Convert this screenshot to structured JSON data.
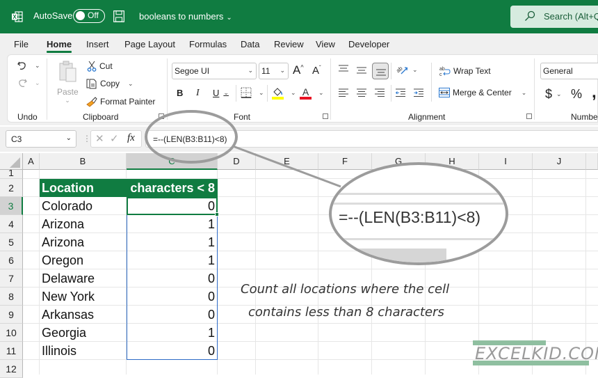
{
  "titlebar": {
    "autosave_label": "AutoSave",
    "autosave_state": "Off",
    "document_name": "booleans to numbers",
    "search_placeholder": "Search (Alt+Q)",
    "colors": {
      "brand": "#107c41"
    }
  },
  "tabs": [
    {
      "label": "File",
      "active": false
    },
    {
      "label": "Home",
      "active": true
    },
    {
      "label": "Insert",
      "active": false
    },
    {
      "label": "Page Layout",
      "active": false
    },
    {
      "label": "Formulas",
      "active": false
    },
    {
      "label": "Data",
      "active": false
    },
    {
      "label": "Review",
      "active": false
    },
    {
      "label": "View",
      "active": false
    },
    {
      "label": "Developer",
      "active": false
    }
  ],
  "ribbon": {
    "undo": {
      "group": "Undo"
    },
    "clipboard": {
      "group": "Clipboard",
      "paste": "Paste",
      "cut": "Cut",
      "copy": "Copy",
      "format_painter": "Format Painter"
    },
    "font": {
      "group": "Font",
      "font_name": "Segoe UI",
      "font_size": "11",
      "bold": "B",
      "italic": "I",
      "underline": "U"
    },
    "alignment": {
      "group": "Alignment",
      "wrap_text": "Wrap Text",
      "merge_center": "Merge & Center"
    },
    "number": {
      "group": "Number",
      "format": "General",
      "currency": "$",
      "percent": "%",
      "comma": ","
    }
  },
  "formula_bar": {
    "name_box": "C3",
    "fx": "fx",
    "formula": "=--(LEN(B3:B11)<8)"
  },
  "sheet": {
    "columns": [
      "A",
      "B",
      "C",
      "D",
      "E",
      "F",
      "G",
      "H",
      "I",
      "J"
    ],
    "selected_column": "C",
    "rows": [
      "1",
      "2",
      "3",
      "4",
      "5",
      "6",
      "7",
      "8",
      "9",
      "10",
      "11",
      "12"
    ],
    "selected_row": "3",
    "header": {
      "location": "Location",
      "result": "characters < 8"
    },
    "data": [
      {
        "location": "Colorado",
        "value": "0"
      },
      {
        "location": "Arizona",
        "value": "1"
      },
      {
        "location": "Arizona",
        "value": "1"
      },
      {
        "location": "Oregon",
        "value": "1"
      },
      {
        "location": "Delaware",
        "value": "0"
      },
      {
        "location": "New York",
        "value": "0"
      },
      {
        "location": "Arkansas",
        "value": "0"
      },
      {
        "location": "Georgia",
        "value": "1"
      },
      {
        "location": "Illinois",
        "value": "0"
      }
    ]
  },
  "annotation": {
    "line1": "Count all locations where the cell",
    "line2": "contains less than 8 characters",
    "magnified_formula": "=--(LEN(B3:B11)<8)"
  },
  "watermark": "EXCELKID.COM"
}
